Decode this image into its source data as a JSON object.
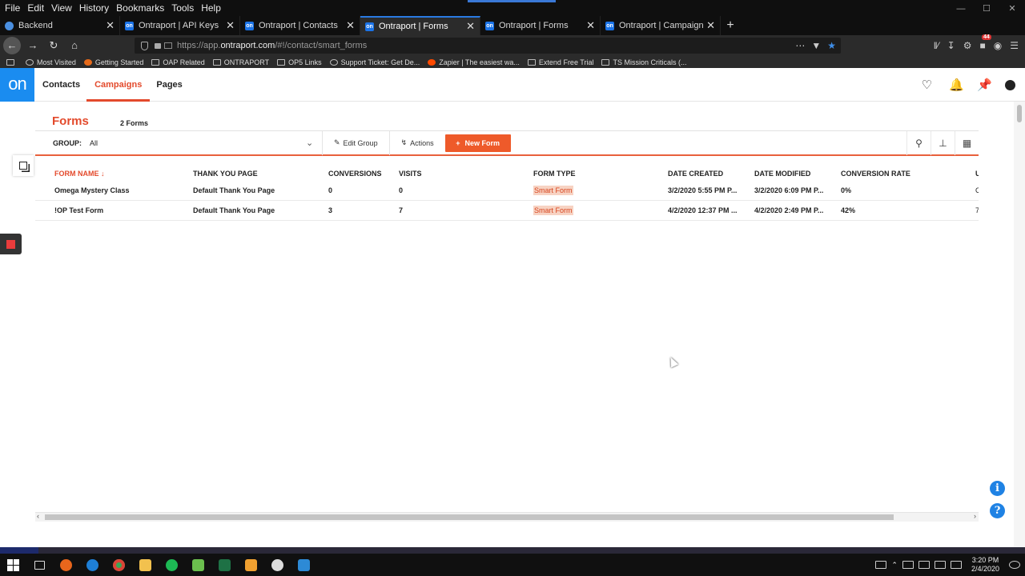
{
  "browser": {
    "menu": [
      {
        "label": "File",
        "u": "F"
      },
      {
        "label": "Edit",
        "u": "E"
      },
      {
        "label": "View",
        "u": "V"
      },
      {
        "label": "History",
        "u": "H"
      },
      {
        "label": "Bookmarks",
        "u": "B"
      },
      {
        "label": "Tools",
        "u": "T"
      },
      {
        "label": "Help",
        "u": "H"
      }
    ],
    "tabs": [
      {
        "label": "Backend",
        "icon": "gear-icon",
        "active": false
      },
      {
        "label": "Ontraport | API Keys",
        "icon": "ontraport-icon",
        "active": false
      },
      {
        "label": "Ontraport | Contacts",
        "icon": "ontraport-icon",
        "active": false
      },
      {
        "label": "Ontraport | Forms",
        "icon": "ontraport-icon",
        "active": true
      },
      {
        "label": "Ontraport | Forms",
        "icon": "ontraport-icon",
        "active": false
      },
      {
        "label": "Ontraport | Campaigns",
        "icon": "ontraport-icon",
        "active": false
      }
    ],
    "url_prefix": "https://app.",
    "url_host": "ontraport.com",
    "url_path": "/#!/contact/smart_forms",
    "extension_badge": "44",
    "bookmarks": [
      {
        "label": "Most Visited",
        "icon": "gear-icon"
      },
      {
        "label": "Getting Started",
        "icon": "firefox-icon"
      },
      {
        "label": "OAP Related",
        "icon": "folder-icon"
      },
      {
        "label": "ONTRAPORT",
        "icon": "folder-icon"
      },
      {
        "label": "OP5 Links",
        "icon": "folder-icon"
      },
      {
        "label": "Support Ticket: Get De...",
        "icon": "globe-icon"
      },
      {
        "label": "Zapier | The easiest wa...",
        "icon": "zapier-icon"
      },
      {
        "label": "Extend Free Trial",
        "icon": "folder-icon"
      },
      {
        "label": "TS Mission Criticals (...",
        "icon": "folder-icon"
      }
    ]
  },
  "app": {
    "logo": "on",
    "nav": [
      {
        "label": "Contacts",
        "active": false
      },
      {
        "label": "Campaigns",
        "active": true
      },
      {
        "label": "Pages",
        "active": false
      }
    ]
  },
  "page": {
    "title": "Forms",
    "count": "2 Forms",
    "group_label": "GROUP:",
    "group_value": "All",
    "edit_group": "Edit Group",
    "actions": "Actions",
    "new_form": "New Form"
  },
  "table": {
    "columns": [
      "FORM NAME",
      "THANK YOU PAGE",
      "CONVERSIONS",
      "VISITS",
      "FORM TYPE",
      "DATE CREATED",
      "DATE MODIFIED",
      "CONVERSION RATE",
      "U"
    ],
    "sort_indicator": "↓",
    "rows": [
      [
        "Omega Mystery Class",
        "Default Thank You Page",
        "0",
        "0",
        "Smart Form",
        "3/2/2020 5:55 PM P...",
        "3/2/2020 6:09 PM P...",
        "0%",
        "C"
      ],
      [
        "!OP Test Form",
        "Default Thank You Page",
        "3",
        "7",
        "Smart Form",
        "4/2/2020 12:37 PM ...",
        "4/2/2020 2:49 PM P...",
        "42%",
        "7"
      ]
    ]
  },
  "taskbar": {
    "time": "3:20 PM",
    "date": "2/4/2020"
  },
  "colors": {
    "accent": "#e34a2c",
    "button": "#ee5a2a",
    "logo": "#1a8cf0",
    "tag_bg": "#f7d3c3"
  }
}
